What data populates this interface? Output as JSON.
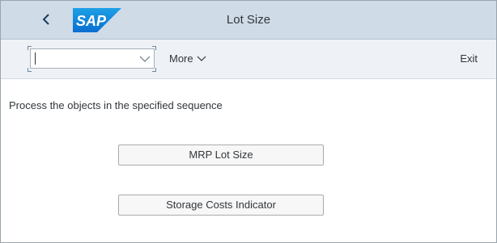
{
  "header": {
    "title": "Lot Size",
    "back_icon": "chevron-left-icon",
    "logo_text": "SAP",
    "logo_color": "#0a6ed1"
  },
  "toolbar": {
    "command_field_value": "",
    "command_field_icon": "chevron-down-icon",
    "more_label": "More",
    "exit_label": "Exit"
  },
  "main": {
    "instruction": "Process the objects in the specified sequence",
    "buttons": [
      {
        "label": "MRP Lot Size"
      },
      {
        "label": "Storage Costs Indicator"
      }
    ]
  },
  "colors": {
    "header_bg": "#cfdbe7",
    "toolbar_bg": "#eef2f6",
    "text": "#32363a"
  }
}
